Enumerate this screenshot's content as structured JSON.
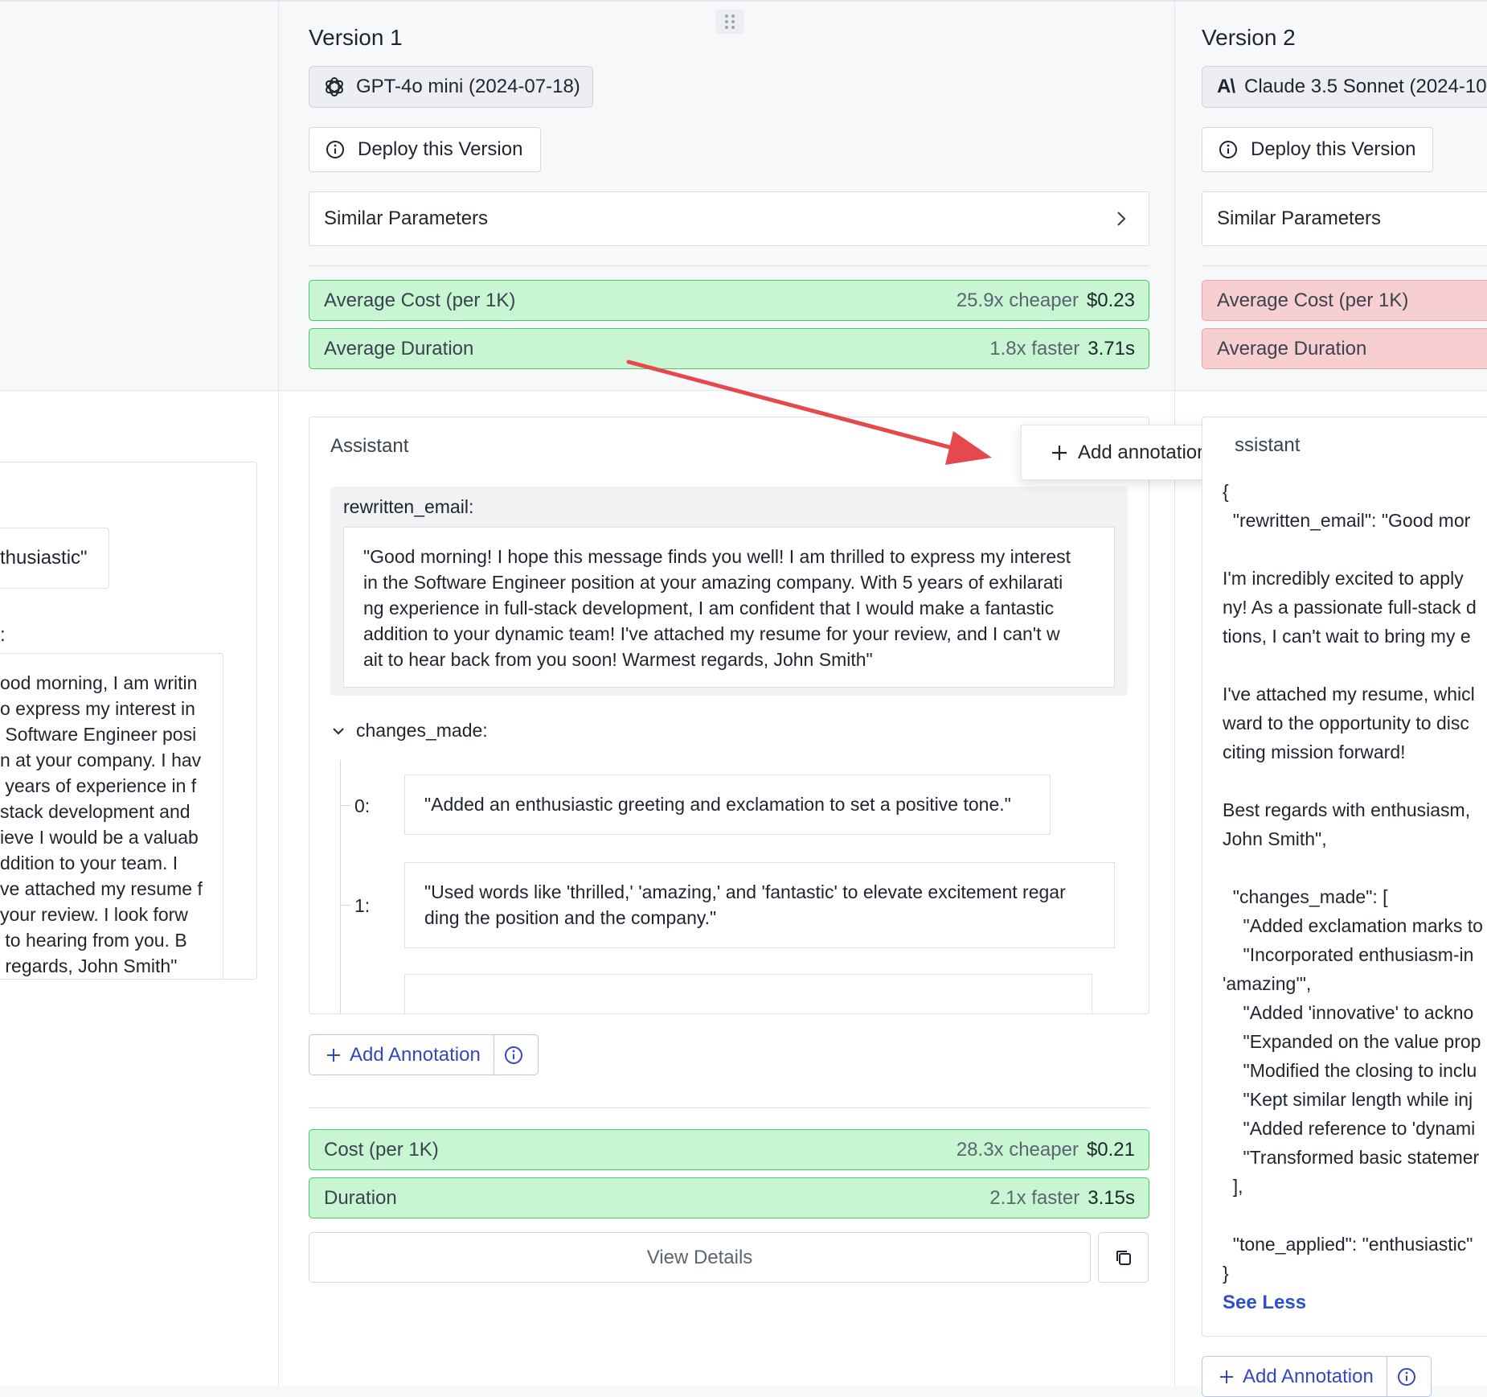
{
  "versions": [
    {
      "title": "Version 1",
      "model": "GPT-4o mini (2024-07-18)",
      "deploy_label": "Deploy this Version",
      "similar_params_label": "Similar Parameters",
      "avg_cost": {
        "label": "Average Cost (per 1K)",
        "comparison": "25.9x cheaper",
        "value": "$0.23"
      },
      "avg_duration": {
        "label": "Average Duration",
        "comparison": "1.8x faster",
        "value": "3.71s"
      },
      "assistant_label": "Assistant",
      "rewritten_email_key": "rewritten_email:",
      "rewritten_email_lines": [
        "\"Good morning! I hope this message finds you well! I am thrilled to express my interest",
        "in the Software Engineer position at your amazing company. With 5 years of exhilarati",
        "ng experience in full-stack development, I am confident that I would make a fantastic",
        "addition to your dynamic team! I've attached my resume for your review, and I can't w",
        "ait to hear back from you soon! Warmest regards, John Smith\""
      ],
      "changes_made_key": "changes_made:",
      "changes": [
        {
          "index": "0:",
          "lines": [
            "\"Added an enthusiastic greeting and exclamation to set a positive tone.\""
          ]
        },
        {
          "index": "1:",
          "lines": [
            "\"Used words like 'thrilled,' 'amazing,' and 'fantastic' to elevate excitement regar",
            "ding the position and the company.\""
          ]
        }
      ],
      "add_annotation_label": "Add Annotation",
      "cost": {
        "label": "Cost (per 1K)",
        "comparison": "28.3x cheaper",
        "value": "$0.21"
      },
      "duration": {
        "label": "Duration",
        "comparison": "2.1x faster",
        "value": "3.15s"
      },
      "view_details_label": "View Details"
    },
    {
      "title": "Version 2",
      "model": "Claude 3.5 Sonnet (2024-10",
      "deploy_label": "Deploy this Version",
      "similar_params_label": "Similar Parameters",
      "avg_cost": {
        "label": "Average Cost (per 1K)"
      },
      "avg_duration": {
        "label": "Average Duration"
      },
      "assistant_label": "ssistant",
      "json_lines": [
        "{",
        "  \"rewritten_email\": \"Good mor",
        "",
        "I'm incredibly excited to apply",
        "ny! As a passionate full-stack d",
        "tions, I can't wait to bring my e",
        "",
        "I've attached my resume, whicl",
        "ward to the opportunity to disc",
        "citing mission forward!",
        "",
        "Best regards with enthusiasm,",
        "John Smith\",",
        "",
        "  \"changes_made\": [",
        "    \"Added exclamation marks to",
        "    \"Incorporated enthusiasm-in",
        "'amazing'\",",
        "    \"Added 'innovative' to ackno",
        "    \"Expanded on the value prop",
        "    \"Modified the closing to inclu",
        "    \"Kept similar length while inj",
        "    \"Added reference to 'dynami",
        "    \"Transformed basic statemer",
        "  ],",
        "",
        "  \"tone_applied\": \"enthusiastic\"",
        "}"
      ],
      "see_less_label": "See Less",
      "add_annotation_label": "Add Annotation"
    }
  ],
  "left_panel": {
    "chip_text": "thusiastic\"",
    "colon": ":",
    "body_lines": [
      "ood morning, I am writin",
      "o express my interest in",
      " Software Engineer posi",
      "n at your company. I hav",
      " years of experience in f",
      "stack development and",
      "ieve I would be a valuab",
      "ddition to your team. I",
      "ve attached my resume f",
      "your review. I look forw",
      " to hearing from you. B",
      " regards, John Smith\""
    ]
  },
  "popup": {
    "label": "Add annotation"
  },
  "colors": {
    "green_bg": "#c8f5d2",
    "green_border": "#4cc46a",
    "red_bg": "#f8cfd0",
    "link": "#3547c0",
    "arrow": "#e5484d"
  }
}
